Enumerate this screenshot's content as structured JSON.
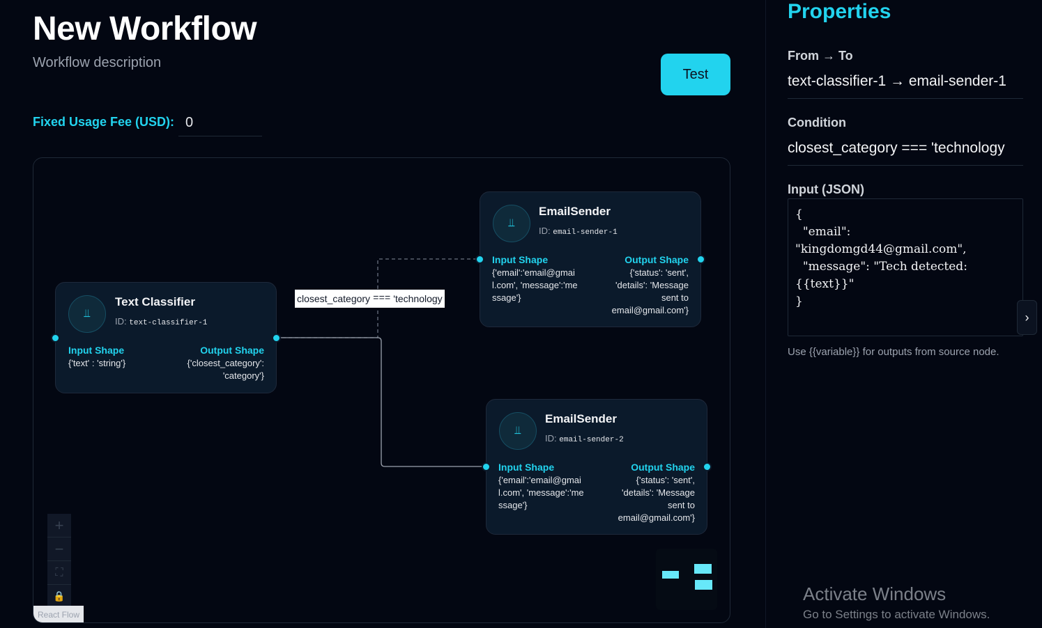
{
  "workflow": {
    "title": "New Workflow",
    "description": "Workflow description",
    "test_label": "Test",
    "fee_label": "Fixed Usage Fee (USD):",
    "fee_value": "0"
  },
  "canvas": {
    "edge_label": {
      "left": "closest_category",
      "operator": "===",
      "right": "'technology"
    },
    "nodes": [
      {
        "title": "Text Classifier",
        "id_label": "ID:",
        "id": "text-classifier-1",
        "input_header": "Input Shape",
        "input_value": "{'text' : 'string'}",
        "output_header": "Output Shape",
        "output_value": "{'closest_category': 'category'}"
      },
      {
        "title": "EmailSender",
        "id_label": "ID:",
        "id": "email-sender-1",
        "input_header": "Input Shape",
        "input_value": "{'email':'email@gmail.com', 'message':'message'}",
        "output_header": "Output Shape",
        "output_value": "{'status': 'sent', 'details': 'Message sent to email@gmail.com'}"
      },
      {
        "title": "EmailSender",
        "id_label": "ID:",
        "id": "email-sender-2",
        "input_header": "Input Shape",
        "input_value": "{'email':'email@gmail.com', 'message':'message'}",
        "output_header": "Output Shape",
        "output_value": "{'status': 'sent', 'details': 'Message sent to email@gmail.com'}"
      }
    ],
    "controls": [
      "+",
      "−",
      "⛶",
      "🔒"
    ],
    "attribution": "React Flow"
  },
  "properties": {
    "title": "Properties",
    "from_to_label": "From → To",
    "from_to_value": "text-classifier-1 → email-sender-1",
    "condition_label": "Condition",
    "condition_value": "closest_category === 'technology",
    "input_label": "Input (JSON)",
    "input_json": "{\n  \"email\":\n\"kingdomgd44@gmail.com\",\n  \"message\": \"Tech detected:\n{{text}}\"\n}",
    "hint": "Use {{variable}} for outputs from source node."
  },
  "watermark": {
    "title": "Activate Windows",
    "subtitle": "Go to Settings to activate Windows."
  },
  "colors": {
    "accent": "#22d3ee",
    "background": "#030712",
    "node_bg": "#0b1a2b"
  },
  "icons": {
    "node_icon": "anchor-icon",
    "collapse": "chevron-right-icon"
  }
}
